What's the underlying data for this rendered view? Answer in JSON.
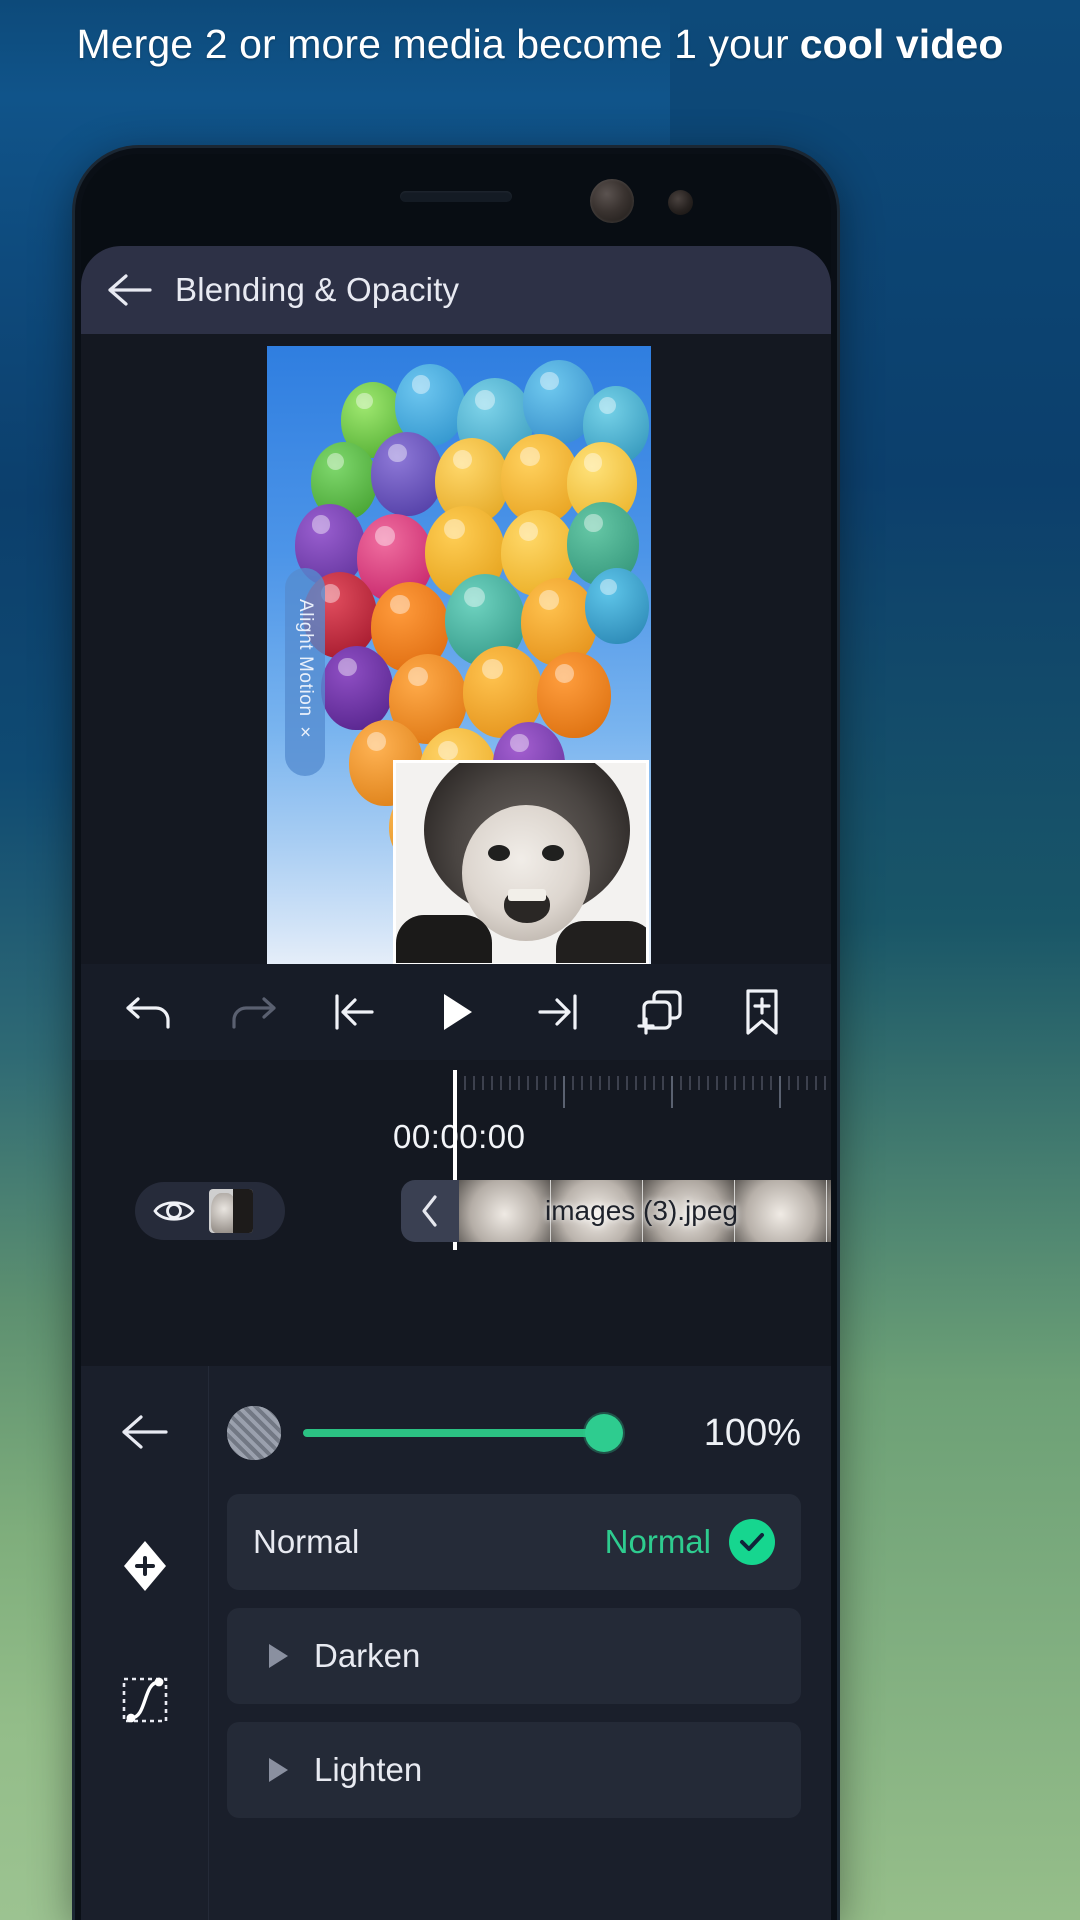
{
  "banner": {
    "text_normal": "Merge 2 or more media become 1 your",
    "text_bold": "cool video"
  },
  "app": {
    "header": {
      "back_icon": "arrow-left-icon",
      "title": "Blending & Opacity"
    },
    "preview": {
      "watermark_text": "Alight Motion ×",
      "watermark_close_icon": "close-icon"
    },
    "toolbar": {
      "items": [
        {
          "name": "undo-button",
          "icon": "undo-icon",
          "enabled": true
        },
        {
          "name": "redo-button",
          "icon": "redo-icon",
          "enabled": false
        },
        {
          "name": "skip-to-start-button",
          "icon": "skip-to-start-icon",
          "enabled": true
        },
        {
          "name": "play-button",
          "icon": "play-icon",
          "enabled": true
        },
        {
          "name": "skip-to-end-button",
          "icon": "skip-to-end-icon",
          "enabled": true
        },
        {
          "name": "add-layer-button",
          "icon": "add-layer-icon",
          "enabled": true
        },
        {
          "name": "add-bookmark-button",
          "icon": "bookmark-plus-icon",
          "enabled": true
        }
      ]
    },
    "timeline": {
      "timecode": "00:00:00",
      "layer": {
        "visibility_icon": "eye-icon",
        "thumbnail": "layer-thumbnail"
      },
      "collapse_icon": "chevron-left-icon",
      "clip_label": "images (3).jpeg"
    },
    "bottom_panel": {
      "rail": [
        {
          "name": "panel-back-button",
          "icon": "arrow-left-icon"
        },
        {
          "name": "keyframe-button",
          "icon": "diamond-plus-icon"
        },
        {
          "name": "easing-curve-button",
          "icon": "easing-curve-icon"
        }
      ],
      "opacity": {
        "icon": "opacity-icon",
        "value": "100%",
        "slider_percent": 100
      },
      "blend_modes": [
        {
          "label": "Normal",
          "value": "Normal",
          "selected": true,
          "expandable": false
        },
        {
          "label": "Darken",
          "value": "",
          "selected": false,
          "expandable": true
        },
        {
          "label": "Lighten",
          "value": "",
          "selected": false,
          "expandable": true
        }
      ]
    }
  },
  "colors": {
    "accent_green": "#2ecc8f",
    "check_green": "#16d68f",
    "header_bar": "#2d3146",
    "panel_bg": "#1a1f2b",
    "row_bg": "#252b38"
  }
}
